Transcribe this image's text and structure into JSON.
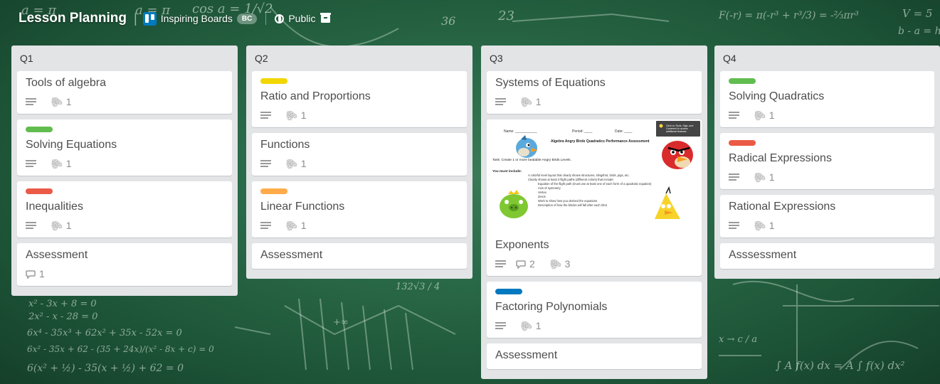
{
  "board": {
    "title": "Lesson Planning",
    "team_name": "Inspiring Boards",
    "team_badge": "BC",
    "visibility": "Public",
    "icons": [
      "trello-logo-icon",
      "globe-icon",
      "archive-icon"
    ]
  },
  "lists": [
    {
      "name": "Q1",
      "cards": [
        {
          "title": "Tools of algebra",
          "label": null,
          "description": true,
          "attachments": "1",
          "comments": null
        },
        {
          "title": "Solving Equations",
          "label": "#61bd4f",
          "description": true,
          "attachments": "1",
          "comments": null
        },
        {
          "title": "Inequalities",
          "label": "#eb5a46",
          "description": true,
          "attachments": "1",
          "comments": null
        },
        {
          "title": "Assessment",
          "label": null,
          "description": false,
          "attachments": null,
          "comments": "1"
        }
      ]
    },
    {
      "name": "Q2",
      "cards": [
        {
          "title": "Ratio and Proportions",
          "label": "#f2d600",
          "description": true,
          "attachments": "1",
          "comments": null
        },
        {
          "title": "Functions",
          "label": null,
          "description": true,
          "attachments": "1",
          "comments": null
        },
        {
          "title": "Linear Functions",
          "label": "#ffab4a",
          "description": true,
          "attachments": "1",
          "comments": null
        },
        {
          "title": "Assessment",
          "label": null,
          "description": false,
          "attachments": null,
          "comments": null
        }
      ]
    },
    {
      "name": "Q3",
      "cards": [
        {
          "title": "Systems of Equations",
          "label": null,
          "description": true,
          "attachments": "1",
          "comments": null
        },
        {
          "title": "Exponents",
          "label": null,
          "cover": true,
          "description": true,
          "attachments": "3",
          "comments": "2"
        },
        {
          "title": "Factoring Polynomials",
          "label": "#0079bf",
          "description": true,
          "attachments": "1",
          "comments": null
        },
        {
          "title": "Assessment",
          "label": null,
          "description": false,
          "attachments": null,
          "comments": null
        }
      ]
    },
    {
      "name": "Q4",
      "cards": [
        {
          "title": "Solving Quadratics",
          "label": "#61bd4f",
          "description": true,
          "attachments": "1",
          "comments": null
        },
        {
          "title": "Radical Expressions",
          "label": "#eb5a46",
          "description": true,
          "attachments": "1",
          "comments": null
        },
        {
          "title": "Rational Expressions",
          "label": null,
          "description": true,
          "attachments": "1",
          "comments": null
        },
        {
          "title": "Asssessment",
          "label": null,
          "description": false,
          "attachments": null,
          "comments": null
        }
      ]
    }
  ],
  "cover_image": {
    "name_label": "Name:",
    "period_label": "Period:",
    "date_label": "Date:",
    "heading": "Algebra Angry Birds Quadratics Performance Assessment",
    "task": "Task: Create 1 or more beatable Angry Birds Levels.",
    "must_include": "You must include:",
    "lines": [
      "A colorful level layout that clearly shows structures, slingshot, birds, pigs, etc.",
      "Clearly shows at least 3 flight paths (different colors) that include:",
      "Equation of the flight path (must use at least one of each form of a quadratic equation)",
      "Axis of symmetry",
      "Vertex",
      "Zeros",
      "Work to show how you derived the equations",
      "Description of how the blocks will fall after each shot"
    ],
    "tooltip": "Click on Tools, Sign, and Comment to access additional features"
  },
  "background_chalk": [
    "a = π",
    "a = π",
    "cos a = 1/√2",
    "36",
    "23",
    "F(-r) = π(-r³ + r³/3) = -⅔πr³",
    "V = 5",
    "b - a = h",
    "x² - 3x + 8 = 0",
    "2x² - x - 28 = 0",
    "6x⁴ - 35x³ + 62x² + 35x - 52x = 0",
    "6x² - 35x + 62 - (35 + 24x)/(x² - 8x + c) = 0",
    "6(x² + ½) - 35(x + ½) + 62 = 0",
    "132√3 / 4",
    "+∞",
    "-∞",
    "x → c / a",
    "∫ A f(x) dx = A ∫ f(x) dx²"
  ]
}
